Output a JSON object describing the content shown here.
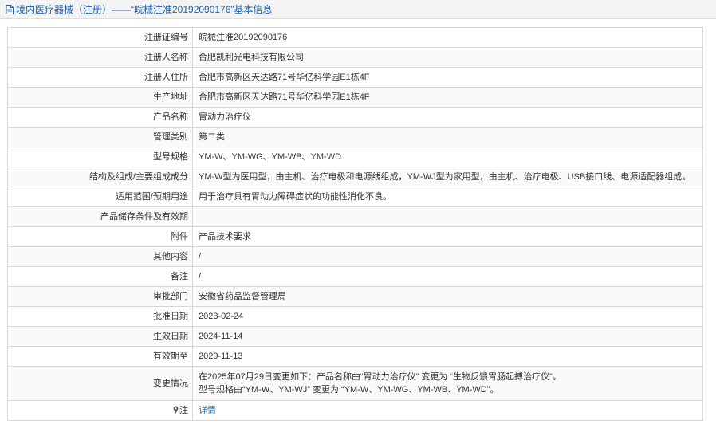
{
  "header": {
    "title": "境内医疗器械（注册）——“皖械注准20192090176”基本信息"
  },
  "rows": [
    {
      "label": "注册证编号",
      "value": "皖械注准20192090176"
    },
    {
      "label": "注册人名称",
      "value": "合肥凯利光电科技有限公司"
    },
    {
      "label": "注册人住所",
      "value": "合肥市高新区天达路71号华亿科学园E1栋4F"
    },
    {
      "label": "生产地址",
      "value": "合肥市高新区天达路71号华亿科学园E1栋4F"
    },
    {
      "label": "产品名称",
      "value": "胃动力治疗仪"
    },
    {
      "label": "管理类别",
      "value": "第二类"
    },
    {
      "label": "型号规格",
      "value": "YM-W、YM-WG、YM-WB、YM-WD"
    },
    {
      "label": "结构及组成/主要组成成分",
      "value": "YM-W型为医用型，由主机、治疗电极和电源线组成，YM-WJ型为家用型，由主机、治疗电极、USB接口线、电源适配器组成。"
    },
    {
      "label": "适用范围/预期用途",
      "value": "用于治疗具有胃动力障碍症状的功能性消化不良。"
    },
    {
      "label": "产品储存条件及有效期",
      "value": ""
    },
    {
      "label": "附件",
      "value": "产品技术要求"
    },
    {
      "label": "其他内容",
      "value": "/"
    },
    {
      "label": "备注",
      "value": "/"
    },
    {
      "label": "审批部门",
      "value": "安徽省药品监督管理局"
    },
    {
      "label": "批准日期",
      "value": "2023-02-24"
    },
    {
      "label": "生效日期",
      "value": "2024-11-14"
    },
    {
      "label": "有效期至",
      "value": "2029-11-13"
    }
  ],
  "change": {
    "label": "变更情况",
    "line1": "在2025年07月29日变更如下：产品名称由“胃动力治疗仪” 变更为 “生物反馈胃肠起搏治疗仪”。",
    "line2": "型号规格由“YM-W、YM-WJ” 变更为 “YM-W、YM-WG、YM-WB、YM-WD”。"
  },
  "note": {
    "label": "注",
    "link_text": "详情"
  },
  "colors": {
    "title": "#1d5fa8",
    "link": "#2a6ebb",
    "border": "#d8d8d8",
    "header_bg": "#f3f3f3"
  },
  "icons": [
    "document-icon",
    "pin-icon"
  ]
}
